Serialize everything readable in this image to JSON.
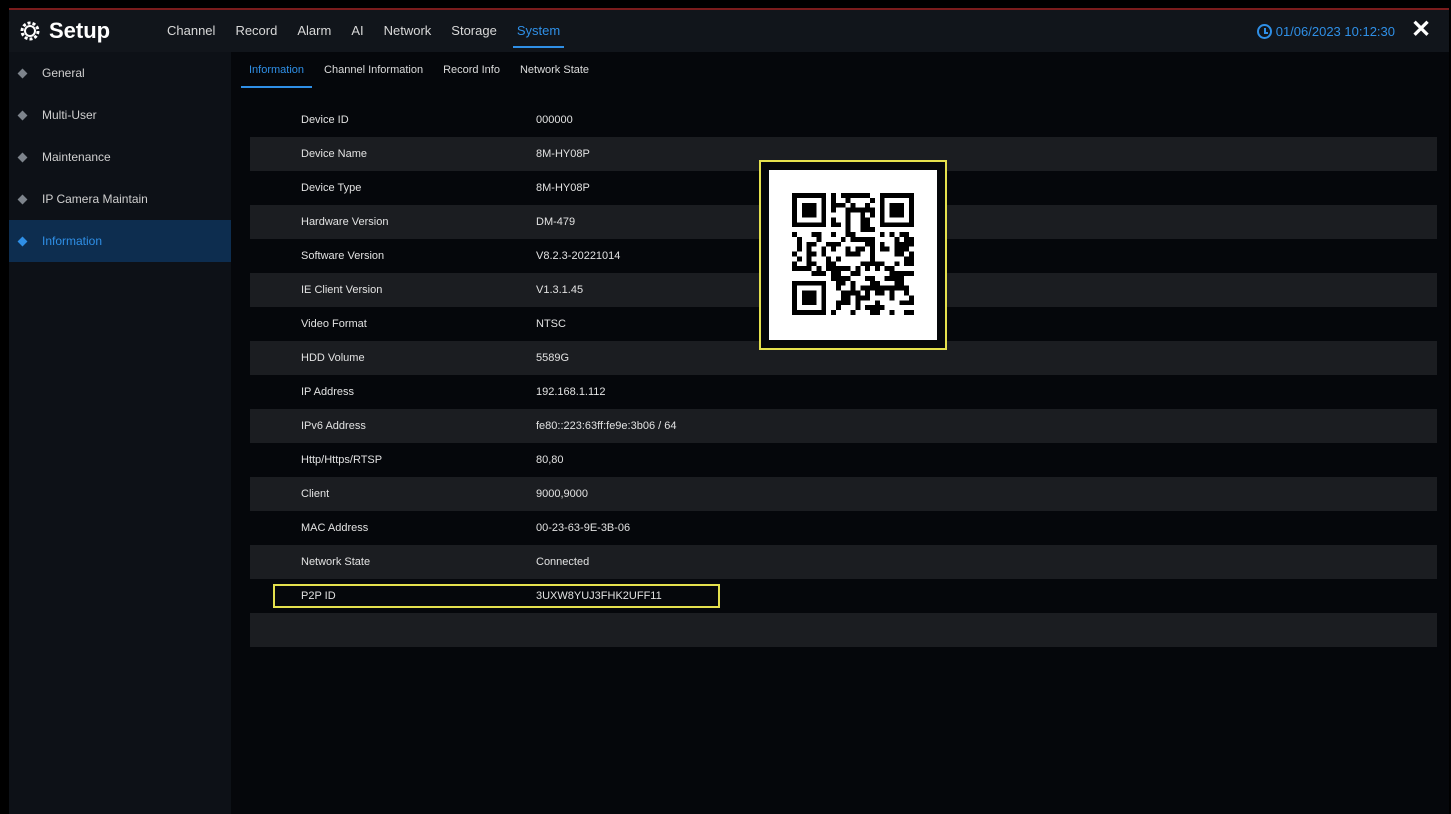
{
  "app": {
    "title": "Setup",
    "datetime": "01/06/2023 10:12:30"
  },
  "topnav": [
    "Channel",
    "Record",
    "Alarm",
    "AI",
    "Network",
    "Storage",
    "System"
  ],
  "sidebar": [
    "General",
    "Multi-User",
    "Maintenance",
    "IP Camera Maintain",
    "Information"
  ],
  "subtabs": [
    "Information",
    "Channel Information",
    "Record Info",
    "Network State"
  ],
  "info": [
    {
      "label": "Device ID",
      "value": "000000"
    },
    {
      "label": "Device Name",
      "value": "8M-HY08P"
    },
    {
      "label": "Device Type",
      "value": "8M-HY08P"
    },
    {
      "label": "Hardware Version",
      "value": "DM-479"
    },
    {
      "label": "Software Version",
      "value": "V8.2.3-20221014"
    },
    {
      "label": "IE Client Version",
      "value": "V1.3.1.45"
    },
    {
      "label": "Video Format",
      "value": "NTSC"
    },
    {
      "label": "HDD Volume",
      "value": "5589G"
    },
    {
      "label": "IP Address",
      "value": "192.168.1.112"
    },
    {
      "label": "IPv6 Address",
      "value": "fe80::223:63ff:fe9e:3b06 / 64"
    },
    {
      "label": "Http/Https/RTSP",
      "value": "80,80"
    },
    {
      "label": "Client",
      "value": "9000,9000"
    },
    {
      "label": "MAC Address",
      "value": "00-23-63-9E-3B-06"
    },
    {
      "label": "Network State",
      "value": "Connected"
    },
    {
      "label": "P2P ID",
      "value": "3UXW8YUJ3FHK2UFF11"
    }
  ],
  "icons": {
    "logo": "gear-icon",
    "clock": "clock-icon",
    "close": "close-icon",
    "qr": "qr-code-icon"
  },
  "colors": {
    "accent": "#2f8fe6",
    "highlight": "#e4e04d"
  }
}
